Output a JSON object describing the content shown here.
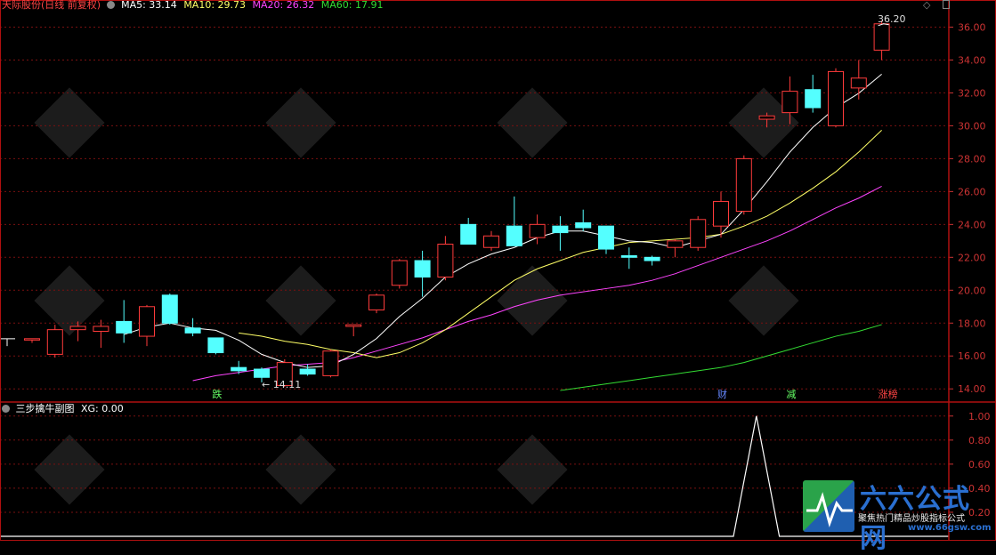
{
  "header": {
    "title": "天际股份(日线 前复权)",
    "ma5_label": "MA5: 33.14",
    "ma10_label": "MA10: 29.73",
    "ma20_label": "MA20: 26.32",
    "ma60_label": "MA60: 17.91"
  },
  "sub_header": {
    "title": "三步擒牛副图",
    "xg_label": "XG: 0.00"
  },
  "colors": {
    "up": "#ff3b3b",
    "down": "#54ffff",
    "ma5": "#ffffff",
    "ma10": "#ffff66",
    "ma20": "#ff44ff",
    "ma60": "#33dd33",
    "grid": "#7a1010",
    "axis_text": "#cc3333"
  },
  "markers": {
    "high": "36.20",
    "low": "← 14.11"
  },
  "event_tags": [
    {
      "text": "跌",
      "color": "#66ff66",
      "bar": 8
    },
    {
      "text": "财",
      "color": "#6688ff",
      "bar": 30
    },
    {
      "text": "减",
      "color": "#66ff66",
      "bar": 33
    },
    {
      "text": "涨榜",
      "color": "#ff4444",
      "bar": 37
    }
  ],
  "watermark": {
    "brand": "六六公式网",
    "slogan": "聚焦热门精品炒股指标公式",
    "url": "www.66gsw.com"
  },
  "chart_data": {
    "type": "candlestick",
    "y_ticks": [
      "14.00",
      "16.00",
      "18.00",
      "20.00",
      "22.00",
      "24.00",
      "26.00",
      "28.00",
      "30.00",
      "32.00",
      "34.00",
      "36.00"
    ],
    "ylim": [
      13.2,
      37.0
    ],
    "sub_y_ticks": [
      "0.20",
      "0.40",
      "0.60",
      "0.80",
      "1.00"
    ],
    "sub_ylim": [
      0,
      1.05
    ],
    "candles": [
      {
        "o": 17.05,
        "h": 17.05,
        "l": 16.8,
        "c": 17.05
      },
      {
        "o": 16.1,
        "h": 17.9,
        "l": 15.9,
        "c": 17.6
      },
      {
        "o": 17.6,
        "h": 18.1,
        "l": 16.9,
        "c": 17.8
      },
      {
        "o": 17.5,
        "h": 18.2,
        "l": 16.5,
        "c": 17.8
      },
      {
        "o": 18.1,
        "h": 19.4,
        "l": 16.8,
        "c": 17.4
      },
      {
        "o": 17.2,
        "h": 19.1,
        "l": 16.6,
        "c": 19.0
      },
      {
        "o": 19.7,
        "h": 19.8,
        "l": 17.9,
        "c": 18.0
      },
      {
        "o": 17.7,
        "h": 18.3,
        "l": 17.2,
        "c": 17.4
      },
      {
        "o": 17.1,
        "h": 17.1,
        "l": 16.1,
        "c": 16.2
      },
      {
        "o": 15.3,
        "h": 15.7,
        "l": 14.9,
        "c": 15.1
      },
      {
        "o": 15.2,
        "h": 15.3,
        "l": 14.4,
        "c": 14.7
      },
      {
        "o": 14.2,
        "h": 15.8,
        "l": 14.11,
        "c": 15.6
      },
      {
        "o": 15.2,
        "h": 15.5,
        "l": 14.8,
        "c": 14.9
      },
      {
        "o": 14.8,
        "h": 16.4,
        "l": 14.7,
        "c": 16.3
      },
      {
        "o": 17.8,
        "h": 17.9,
        "l": 17.2,
        "c": 17.9
      },
      {
        "o": 18.8,
        "h": 19.8,
        "l": 18.6,
        "c": 19.7
      },
      {
        "o": 20.3,
        "h": 21.9,
        "l": 20.1,
        "c": 21.8
      },
      {
        "o": 21.8,
        "h": 22.4,
        "l": 19.6,
        "c": 20.8
      },
      {
        "o": 20.8,
        "h": 23.3,
        "l": 20.6,
        "c": 22.8
      },
      {
        "o": 24.0,
        "h": 24.4,
        "l": 22.9,
        "c": 22.8
      },
      {
        "o": 22.6,
        "h": 23.6,
        "l": 22.4,
        "c": 23.3
      },
      {
        "o": 23.9,
        "h": 25.7,
        "l": 22.7,
        "c": 22.7
      },
      {
        "o": 23.2,
        "h": 24.6,
        "l": 22.8,
        "c": 24.0
      },
      {
        "o": 23.9,
        "h": 24.5,
        "l": 22.4,
        "c": 23.5
      },
      {
        "o": 24.1,
        "h": 24.9,
        "l": 23.6,
        "c": 23.8
      },
      {
        "o": 23.9,
        "h": 23.9,
        "l": 22.2,
        "c": 22.5
      },
      {
        "o": 22.1,
        "h": 22.6,
        "l": 21.3,
        "c": 22.0
      },
      {
        "o": 22.0,
        "h": 22.1,
        "l": 21.5,
        "c": 21.8
      },
      {
        "o": 22.6,
        "h": 23.1,
        "l": 22.0,
        "c": 23.0
      },
      {
        "o": 22.6,
        "h": 24.5,
        "l": 22.4,
        "c": 24.3
      },
      {
        "o": 23.9,
        "h": 26.0,
        "l": 23.2,
        "c": 25.4
      },
      {
        "o": 24.8,
        "h": 28.2,
        "l": 24.6,
        "c": 28.0
      },
      {
        "o": 30.4,
        "h": 30.8,
        "l": 29.9,
        "c": 30.6
      },
      {
        "o": 30.8,
        "h": 33.0,
        "l": 30.1,
        "c": 32.1
      },
      {
        "o": 32.2,
        "h": 33.1,
        "l": 30.8,
        "c": 31.1
      },
      {
        "o": 30.0,
        "h": 33.5,
        "l": 29.9,
        "c": 33.3
      },
      {
        "o": 32.3,
        "h": 34.0,
        "l": 31.6,
        "c": 32.9
      },
      {
        "o": 34.6,
        "h": 36.4,
        "l": 34.0,
        "c": 36.2
      }
    ],
    "ma5": [
      null,
      null,
      null,
      null,
      17.3,
      17.76,
      18.0,
      17.7,
      17.56,
      16.96,
      16.1,
      15.6,
      15.3,
      15.4,
      16.1,
      17.06,
      18.4,
      19.5,
      20.8,
      21.6,
      22.2,
      22.6,
      23.2,
      23.6,
      23.6,
      23.3,
      23.0,
      22.9,
      22.6,
      23.0,
      23.4,
      24.9,
      26.6,
      28.4,
      29.9,
      31.1,
      31.98,
      33.14
    ],
    "ma10": [
      null,
      null,
      null,
      null,
      null,
      null,
      null,
      null,
      null,
      17.4,
      17.2,
      16.9,
      16.7,
      16.4,
      16.2,
      15.9,
      16.2,
      16.8,
      17.6,
      18.6,
      19.6,
      20.6,
      21.3,
      21.8,
      22.3,
      22.6,
      22.9,
      23.0,
      23.1,
      23.2,
      23.4,
      23.9,
      24.5,
      25.3,
      26.2,
      27.2,
      28.4,
      29.73
    ],
    "ma20": [
      null,
      null,
      null,
      null,
      null,
      null,
      null,
      14.5,
      14.8,
      15.0,
      15.2,
      15.4,
      15.5,
      15.6,
      15.9,
      16.3,
      16.7,
      17.1,
      17.6,
      18.1,
      18.5,
      19.0,
      19.4,
      19.7,
      19.9,
      20.1,
      20.3,
      20.6,
      21.0,
      21.5,
      22.0,
      22.5,
      23.0,
      23.6,
      24.3,
      25.0,
      25.6,
      26.32
    ],
    "ma60": [
      null,
      null,
      null,
      null,
      null,
      null,
      null,
      null,
      null,
      null,
      null,
      null,
      null,
      null,
      null,
      null,
      null,
      null,
      null,
      null,
      null,
      null,
      null,
      13.9,
      14.1,
      14.3,
      14.5,
      14.7,
      14.9,
      15.1,
      15.3,
      15.6,
      16.0,
      16.4,
      16.8,
      17.2,
      17.5,
      17.91
    ],
    "xg": [
      0,
      0,
      0,
      0,
      0,
      0,
      0,
      0,
      0,
      0,
      0,
      0,
      0,
      0,
      0,
      0,
      0,
      0,
      0,
      0,
      0,
      0,
      0,
      0,
      0,
      0,
      0,
      0,
      0,
      0,
      0,
      1,
      0,
      0,
      0,
      0,
      0,
      0
    ]
  }
}
